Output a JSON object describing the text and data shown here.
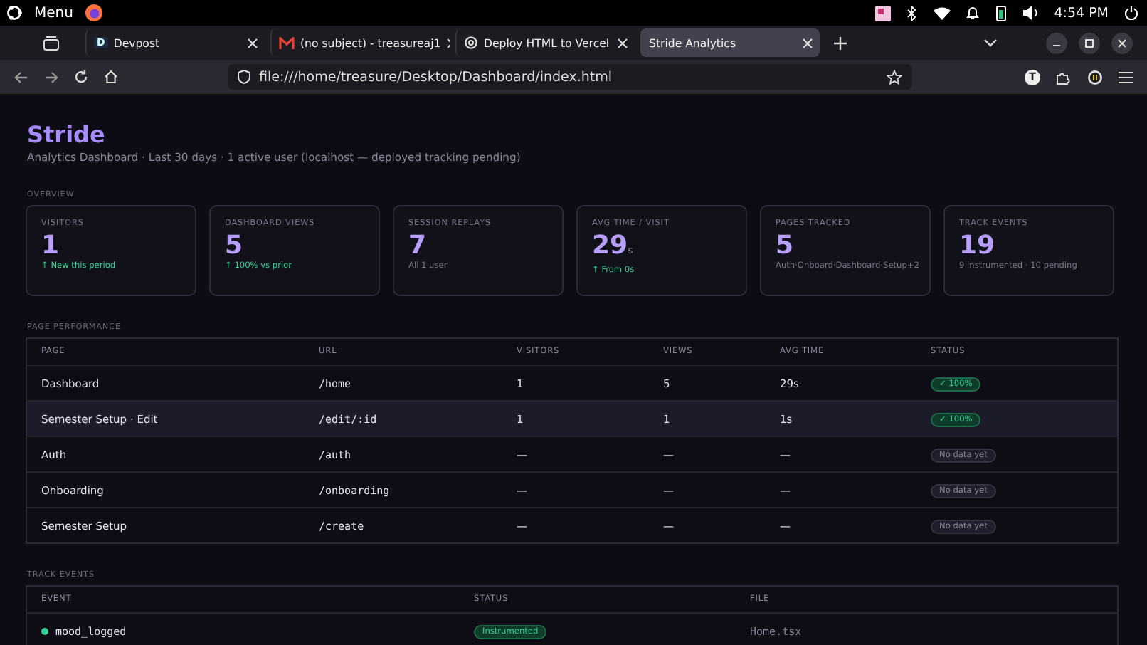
{
  "system_bar": {
    "menu_label": "Menu",
    "time": "4:54 PM"
  },
  "browser": {
    "tabs": [
      {
        "title": "Devpost",
        "favicon": "D",
        "kind": "letter",
        "selected": false
      },
      {
        "title": "(no subject) - treasureaj1",
        "kind": "mail",
        "selected": false
      },
      {
        "title": "Deploy HTML to Vercel",
        "kind": "ai",
        "selected": false
      },
      {
        "title": "Stride Analytics",
        "kind": "none",
        "selected": true
      }
    ],
    "url": "file:///home/treasure/Desktop/Dashboard/index.html",
    "profile_initial": "T"
  },
  "page": {
    "title": "Stride",
    "subtitle": "Analytics Dashboard · Last 30 days · 1 active user (localhost — deployed tracking pending)",
    "overview_label": "OVERVIEW",
    "cards": [
      {
        "label": "VISITORS",
        "value": "1",
        "note": "↑ New this period",
        "kind": "up"
      },
      {
        "label": "DASHBOARD VIEWS",
        "value": "5",
        "note": "↑ 100% vs prior",
        "kind": "up"
      },
      {
        "label": "SESSION REPLAYS",
        "value": "7",
        "note": "All 1 user",
        "kind": "neutral"
      },
      {
        "label": "AVG TIME / VISIT",
        "value": "29",
        "unit": "s",
        "note": "↑ From 0s",
        "kind": "up"
      },
      {
        "label": "PAGES TRACKED",
        "value": "5",
        "note": "Auth·Onboard·Dashboard·Setup+2",
        "kind": "neutral"
      },
      {
        "label": "TRACK EVENTS",
        "value": "19",
        "note": "9 instrumented · 10 pending",
        "kind": "neutral"
      }
    ],
    "performance": {
      "label": "PAGE PERFORMANCE",
      "columns": [
        "PAGE",
        "URL",
        "VISITORS",
        "VIEWS",
        "AVG TIME",
        "STATUS"
      ],
      "rows": [
        {
          "page": "Dashboard",
          "url": "/home",
          "visitors": "1",
          "views": "5",
          "avg_time": "29s",
          "status": "✓ 100%",
          "kind": "ok",
          "highlighted": false
        },
        {
          "page": "Semester Setup · Edit",
          "url": "/edit/:id",
          "visitors": "1",
          "views": "1",
          "avg_time": "1s",
          "status": "✓ 100%",
          "kind": "ok",
          "highlighted": true
        },
        {
          "page": "Auth",
          "url": "/auth",
          "visitors": "—",
          "views": "—",
          "avg_time": "—",
          "status": "No data yet",
          "kind": "none",
          "highlighted": false
        },
        {
          "page": "Onboarding",
          "url": "/onboarding",
          "visitors": "—",
          "views": "—",
          "avg_time": "—",
          "status": "No data yet",
          "kind": "none",
          "highlighted": false
        },
        {
          "page": "Semester Setup",
          "url": "/create",
          "visitors": "—",
          "views": "—",
          "avg_time": "—",
          "status": "No data yet",
          "kind": "none",
          "highlighted": false
        }
      ]
    },
    "events": {
      "label": "TRACK EVENTS",
      "columns": [
        "EVENT",
        "STATUS",
        "FILE"
      ],
      "rows": [
        {
          "event": "mood_logged",
          "color": "#34d399",
          "status": "Instrumented",
          "kind": "instrumented",
          "file": "Home.tsx"
        }
      ]
    }
  }
}
